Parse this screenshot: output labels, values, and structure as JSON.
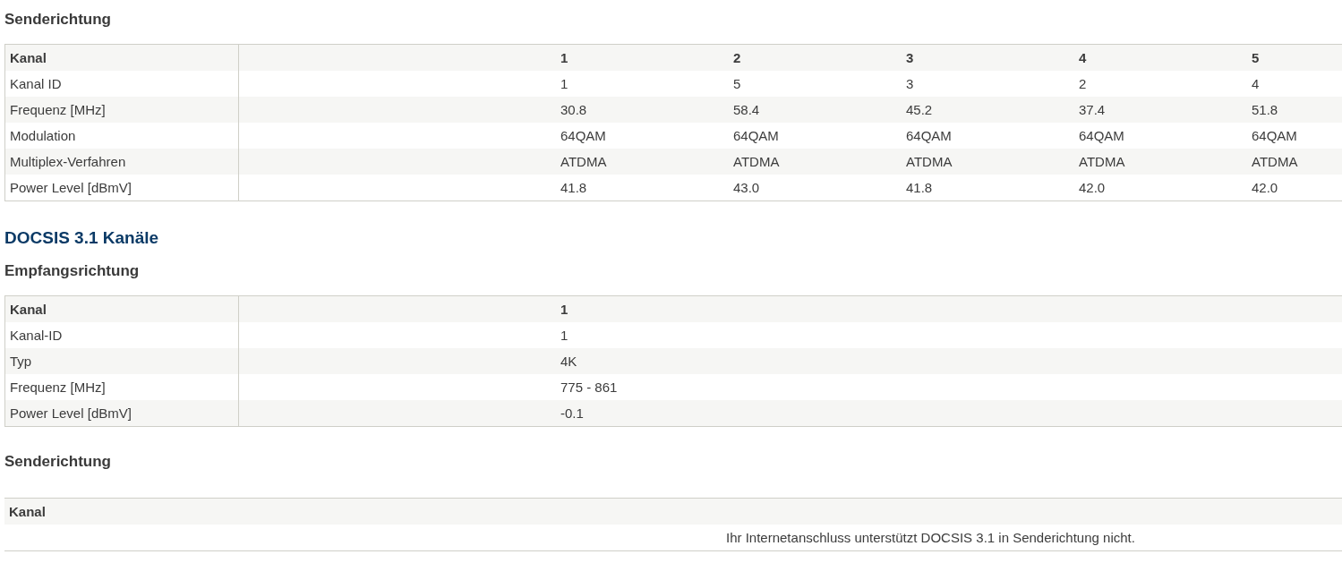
{
  "docsis30_upstream": {
    "title": "Senderichtung",
    "header": {
      "label": "Kanal",
      "values": [
        "1",
        "2",
        "3",
        "4",
        "5"
      ]
    },
    "rows": [
      {
        "label": "Kanal ID",
        "values": [
          "1",
          "5",
          "3",
          "2",
          "4"
        ]
      },
      {
        "label": "Frequenz [MHz]",
        "values": [
          "30.8",
          "58.4",
          "45.2",
          "37.4",
          "51.8"
        ]
      },
      {
        "label": "Modulation",
        "values": [
          "64QAM",
          "64QAM",
          "64QAM",
          "64QAM",
          "64QAM"
        ]
      },
      {
        "label": "Multiplex-Verfahren",
        "values": [
          "ATDMA",
          "ATDMA",
          "ATDMA",
          "ATDMA",
          "ATDMA"
        ]
      },
      {
        "label": "Power Level [dBmV]",
        "values": [
          "41.8",
          "43.0",
          "41.8",
          "42.0",
          "42.0"
        ]
      }
    ]
  },
  "docsis31": {
    "title": "DOCSIS 3.1 Kanäle",
    "downstream": {
      "title": "Empfangsrichtung",
      "header": {
        "label": "Kanal",
        "values": [
          "1"
        ]
      },
      "rows": [
        {
          "label": "Kanal-ID",
          "values": [
            "1"
          ]
        },
        {
          "label": "Typ",
          "values": [
            "4K"
          ]
        },
        {
          "label": "Frequenz [MHz]",
          "values": [
            "775 - 861"
          ]
        },
        {
          "label": "Power Level [dBmV]",
          "values": [
            "-0.1"
          ]
        }
      ]
    },
    "upstream": {
      "title": "Senderichtung",
      "header": {
        "label": "Kanal"
      },
      "message": "Ihr Internetanschluss unterstützt DOCSIS 3.1 in Senderichtung nicht."
    }
  }
}
